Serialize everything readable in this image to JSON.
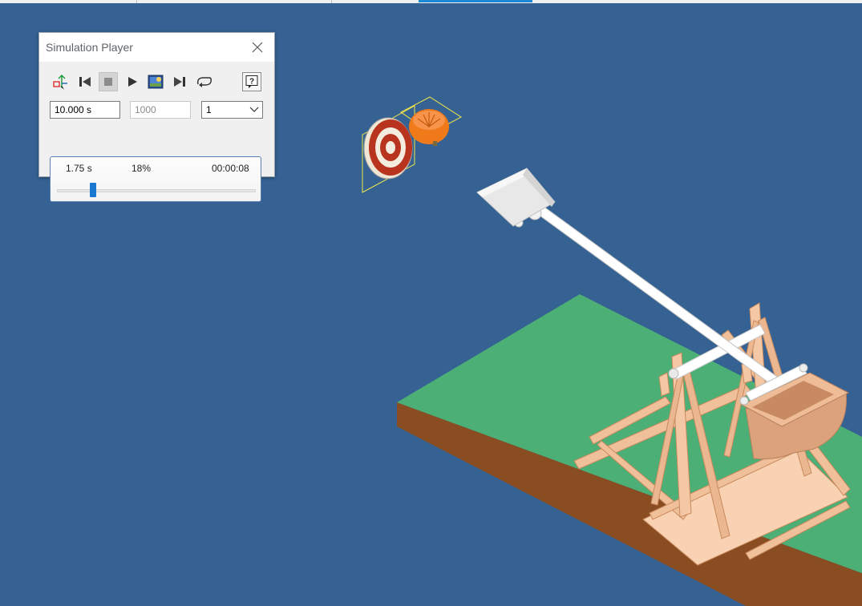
{
  "simulation_player": {
    "title": "Simulation Player",
    "toolbar": {
      "construct_mode": "construct-mode-icon",
      "rewind": "rewind-to-start-icon",
      "stop": "stop-icon",
      "play": "play-icon",
      "record": "record-animation-icon",
      "end": "go-to-end-icon",
      "loop": "loop-icon",
      "help": "help-icon"
    },
    "final_time": "10.000 s",
    "images": "1000",
    "filter": "1",
    "status": {
      "current_time": "1.75 s",
      "percent_text": "18%",
      "elapsed": "00:00:08",
      "progress_fraction": 0.18
    }
  },
  "colors": {
    "viewport_background": "#356293",
    "ground_top": "#4caf76",
    "ground_side": "#8a4d22",
    "wood": "#f2c39d",
    "pumpkin": "#f07a1a",
    "target_red": "#b8341e",
    "selection_highlight": "#f0e64a"
  }
}
